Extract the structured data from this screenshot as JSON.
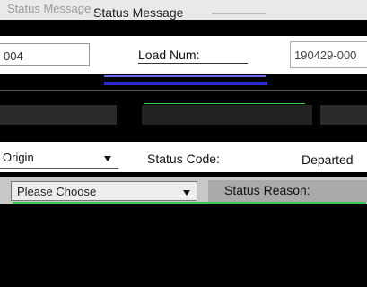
{
  "window": {
    "title_ghost": "Status Message",
    "title": "Status Message"
  },
  "load": {
    "left_value": "004",
    "label": "Load Num:",
    "value": "190429-000"
  },
  "origin": {
    "value": "Origin",
    "dropdown_icon": "chevron-down-icon"
  },
  "status": {
    "code_label": "Status Code:",
    "code_value": "Departed"
  },
  "reason": {
    "placeholder": "Please Choose",
    "label": "Status Reason:"
  },
  "colors": {
    "accent_blue": "#2b2bd6",
    "accent_green": "#3ad14a"
  }
}
